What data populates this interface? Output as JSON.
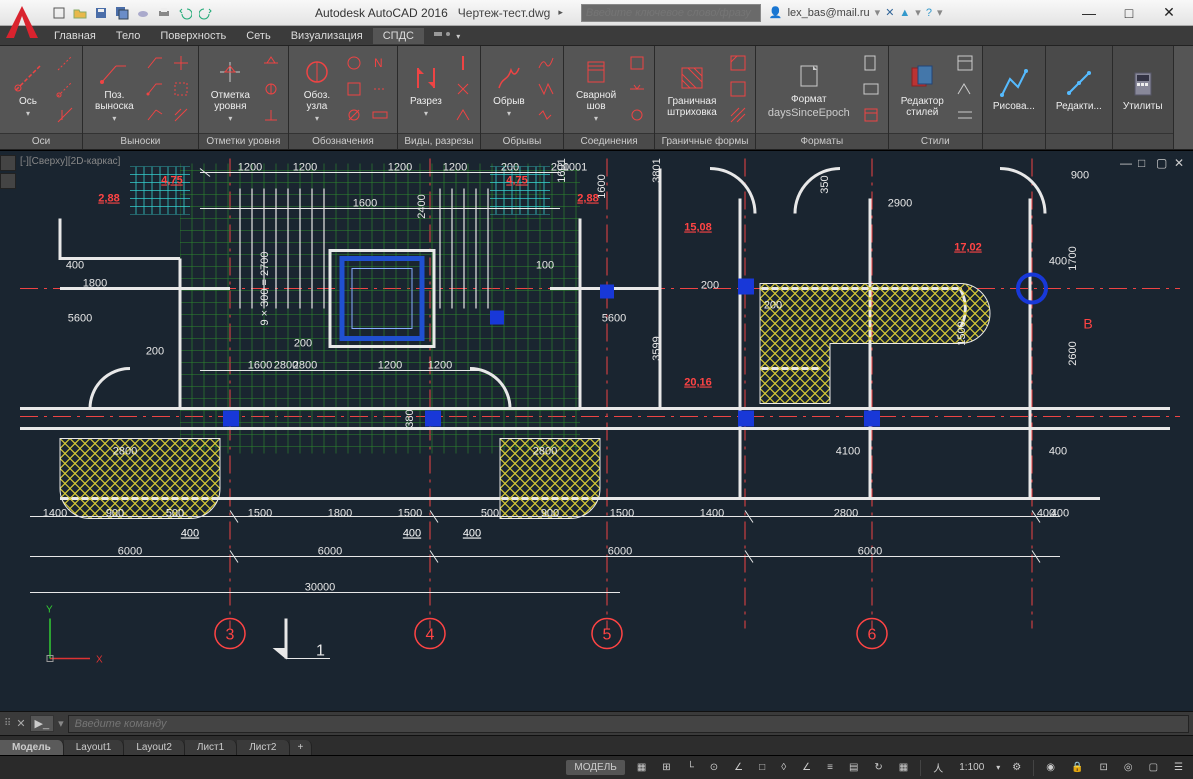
{
  "title": {
    "app": "Autodesk AutoCAD 2016",
    "file": "Чертеж-тест.dwg"
  },
  "search": {
    "placeholder": "Введите ключевое слово/фразу"
  },
  "user": "lex_bas@mail.ru",
  "menubar": [
    "Главная",
    "Тело",
    "Поверхность",
    "Сеть",
    "Визуализация",
    "СПДС"
  ],
  "active_menu": "СПДС",
  "ribbon": {
    "panels": [
      {
        "title": "Оси",
        "main": "Ось"
      },
      {
        "title": "Выноски",
        "main": "Поз.\nвыноска"
      },
      {
        "title": "Отметки уровня",
        "main": "Отметка\nуровня"
      },
      {
        "title": "Обозначения",
        "main": "Обоз.\nузла"
      },
      {
        "title": "Виды, разрезы",
        "main": "Разрез"
      },
      {
        "title": "Обрывы",
        "main": "Обрыв"
      },
      {
        "title": "Соединения",
        "main": "Сварной\nшов"
      },
      {
        "title": "Граничные формы",
        "main": "Граничная\nштриховка"
      },
      {
        "title": "Форматы",
        "main": "Формат"
      },
      {
        "title": "Стили",
        "main": "Редактор\nстилей"
      },
      {
        "title": "",
        "main": "Рисова..."
      },
      {
        "title": "",
        "main": "Редакти..."
      },
      {
        "title": "",
        "main": "Утилиты"
      }
    ]
  },
  "viewport": {
    "label": "[-][Сверху][2D-каркас]"
  },
  "drawing": {
    "gridAxes": [
      "3",
      "4",
      "5",
      "6"
    ],
    "gridAxisLabelB": "В",
    "totalWidth": "30000",
    "span6000": "6000",
    "dims": {
      "top": [
        "1200",
        "1200",
        "1200",
        "1200",
        "200",
        "200",
        "3801",
        "900"
      ],
      "mid": [
        "1600",
        "2400",
        "1600",
        "350",
        "1601",
        "1001"
      ],
      "smalldims": [
        "400",
        "100",
        "380",
        "200",
        "500",
        "1500",
        "2800",
        "5600",
        "1400",
        "900",
        "2900",
        "1700",
        "2600",
        "4100",
        "1800",
        "3599"
      ],
      "areas": [
        "2,88",
        "4,75",
        "2,88",
        "4,75",
        "15,08",
        "17,02",
        "20,16"
      ],
      "section": "1",
      "formula": "9 × 300 = 2700"
    }
  },
  "command": {
    "placeholder": "Введите команду"
  },
  "layoutTabs": [
    "Модель",
    "Layout1",
    "Layout2",
    "Лист1",
    "Лист2"
  ],
  "active_layout": "Модель",
  "status": {
    "model": "МОДЕЛЬ",
    "scale": "1:100"
  }
}
